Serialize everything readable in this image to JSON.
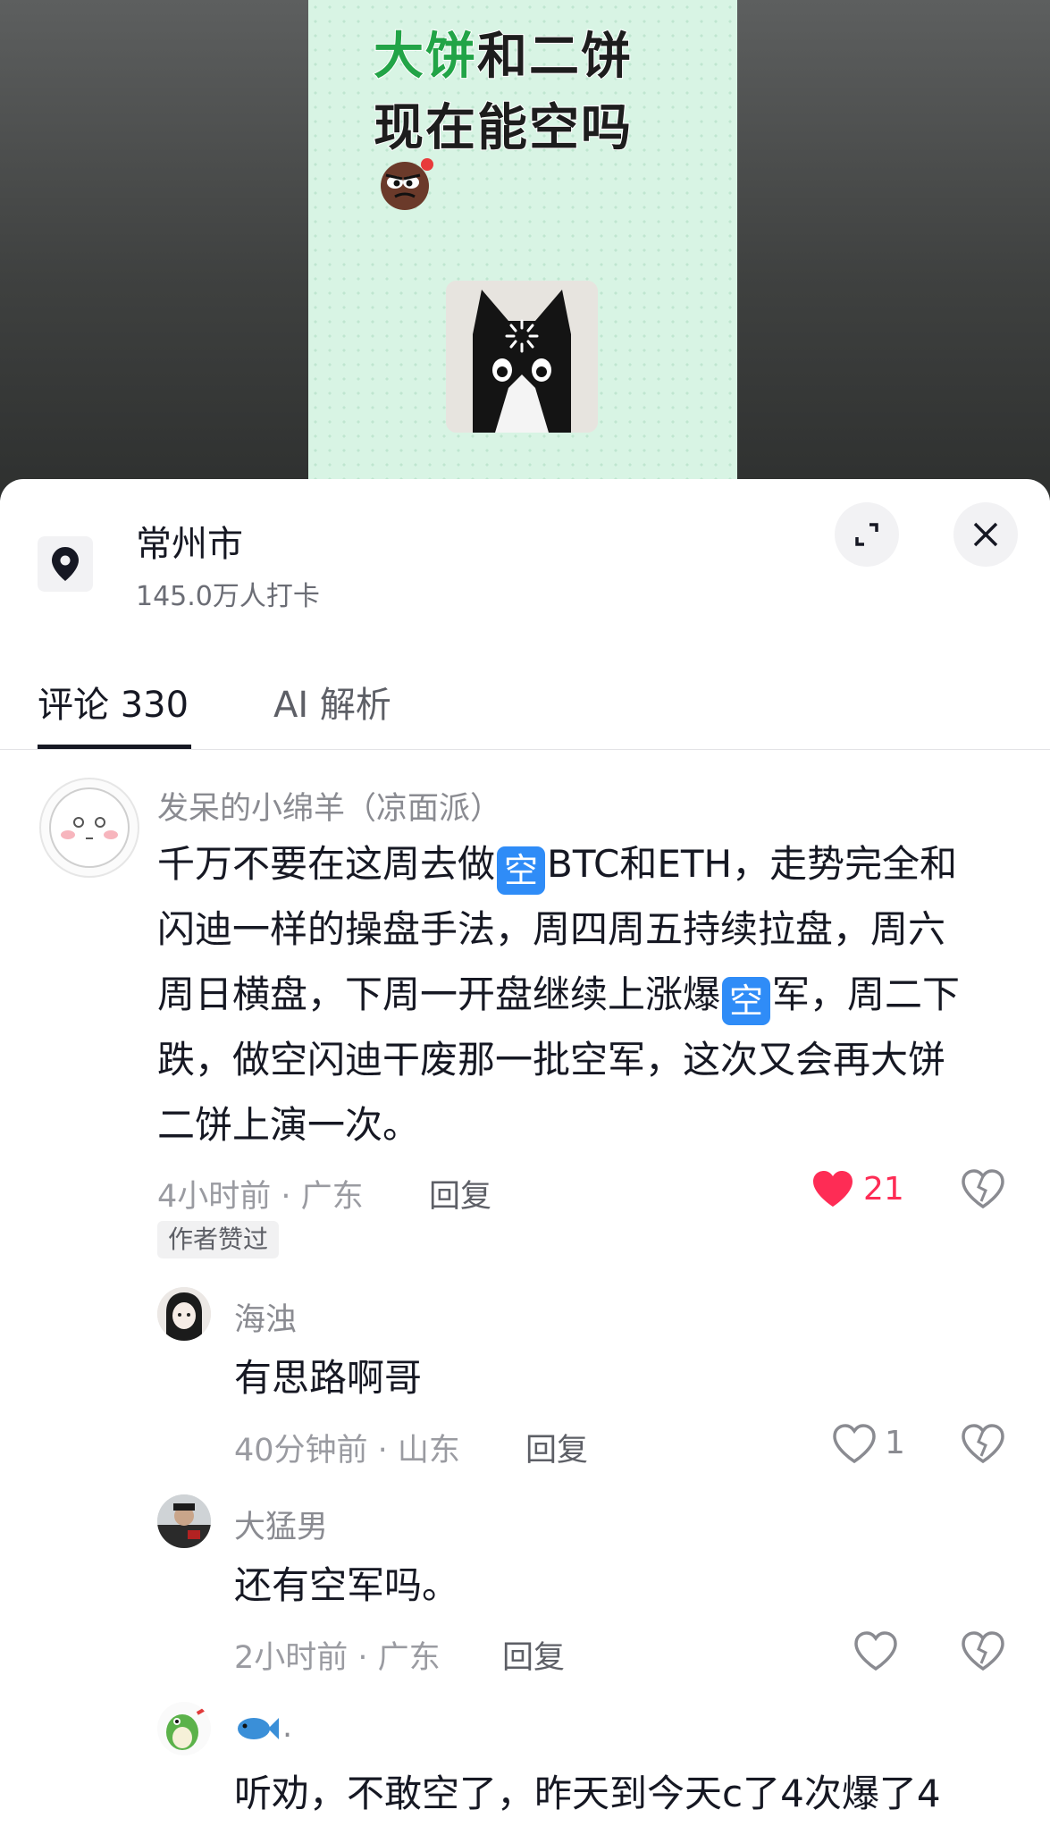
{
  "video": {
    "poster_line1_green": "大饼",
    "poster_line1_dark": "和二饼",
    "poster_line2": "现在能空吗",
    "emoji_icon": "angry-face-icon",
    "thumbnail": "cat-loading-thumbnail"
  },
  "location": {
    "title": "常州市",
    "subtitle": "145.0万人打卡",
    "icon": "location-pin-icon"
  },
  "header_buttons": {
    "expand_icon": "expand-icon",
    "close_icon": "close-icon"
  },
  "tabs": [
    {
      "label": "评论 330",
      "active": true
    },
    {
      "label": "AI 解析",
      "active": false
    }
  ],
  "comments": [
    {
      "nickname": "发呆的小绵羊（凉面派）",
      "content": {
        "line1_a": "千万不要在这周去做",
        "badge": "空",
        "line1_b": "BTC和ETH，走势完全和",
        "line2": "闪迪一样的操盘手法，周四周五持续拉盘，周六",
        "line3_a": "周日横盘，下周一开盘继续上涨爆",
        "line3_b": "军，周二下",
        "line4": "跌，做空闪迪干废那一批空军，这次又会再大饼",
        "line5": "二饼上演一次。"
      },
      "meta": "4小时前 · 广东",
      "reply": "回复",
      "likes": "21",
      "liked": true,
      "badge": "作者赞过"
    }
  ],
  "replies": [
    {
      "nickname": "海浊",
      "content": "有思路啊哥",
      "meta": "40分钟前 · 山东",
      "reply": "回复",
      "likes": "1"
    },
    {
      "nickname": "大猛男",
      "content": "还有空军吗。",
      "meta": "2小时前 · 广东",
      "reply": "回复",
      "likes": ""
    },
    {
      "nickname": ".",
      "content": "听劝，不敢空了，昨天到今天c了4次爆了4",
      "meta": "",
      "reply": "",
      "likes": ""
    }
  ],
  "colors": {
    "like_red": "#fe2c55",
    "kong_badge_blue": "#2f8cf7",
    "poster_green": "#22a447"
  }
}
